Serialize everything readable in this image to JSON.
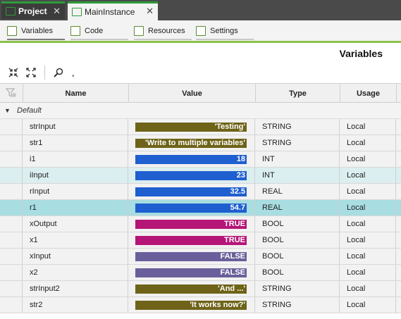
{
  "tabs": [
    {
      "label": "Project",
      "active": false
    },
    {
      "label": "MainInstance",
      "active": true
    }
  ],
  "subtabs": [
    {
      "label": "Variables",
      "active": true
    },
    {
      "label": "Code",
      "active": false
    },
    {
      "label": "Resources",
      "active": false
    },
    {
      "label": "Settings",
      "active": false
    }
  ],
  "page_title": "Variables",
  "columns": [
    "Name",
    "Value",
    "Type",
    "Usage"
  ],
  "group_label": "Default",
  "type_colors": {
    "STRING": "#6e6318",
    "INT": "#1f5fcf",
    "REAL": "#1f5fcf",
    "BOOL_TRUE": "#b51577",
    "BOOL_FALSE": "#6a5f9a"
  },
  "rows": [
    {
      "name": "strInput",
      "value": "'Testing'",
      "type": "STRING",
      "usage": "Local",
      "color": "#6e6318",
      "state": ""
    },
    {
      "name": "str1",
      "value": "'Write to multiple variables'",
      "type": "STRING",
      "usage": "Local",
      "color": "#6e6318",
      "state": ""
    },
    {
      "name": "i1",
      "value": "18",
      "type": "INT",
      "usage": "Local",
      "color": "#1f5fcf",
      "state": ""
    },
    {
      "name": "iInput",
      "value": "23",
      "type": "INT",
      "usage": "Local",
      "color": "#1f5fcf",
      "state": "sel-light"
    },
    {
      "name": "rInput",
      "value": "32.5",
      "type": "REAL",
      "usage": "Local",
      "color": "#1f5fcf",
      "state": ""
    },
    {
      "name": "r1",
      "value": "54.7",
      "type": "REAL",
      "usage": "Local",
      "color": "#1f5fcf",
      "state": "sel"
    },
    {
      "name": "xOutput",
      "value": "TRUE",
      "type": "BOOL",
      "usage": "Local",
      "color": "#b51577",
      "state": ""
    },
    {
      "name": "x1",
      "value": "TRUE",
      "type": "BOOL",
      "usage": "Local",
      "color": "#b51577",
      "state": ""
    },
    {
      "name": "xInput",
      "value": "FALSE",
      "type": "BOOL",
      "usage": "Local",
      "color": "#6a5f9a",
      "state": ""
    },
    {
      "name": "x2",
      "value": "FALSE",
      "type": "BOOL",
      "usage": "Local",
      "color": "#6a5f9a",
      "state": ""
    },
    {
      "name": "strInput2",
      "value": "'And ...'",
      "type": "STRING",
      "usage": "Local",
      "color": "#6e6318",
      "state": ""
    },
    {
      "name": "str2",
      "value": "'It works now?'",
      "type": "STRING",
      "usage": "Local",
      "color": "#6e6318",
      "state": ""
    }
  ]
}
